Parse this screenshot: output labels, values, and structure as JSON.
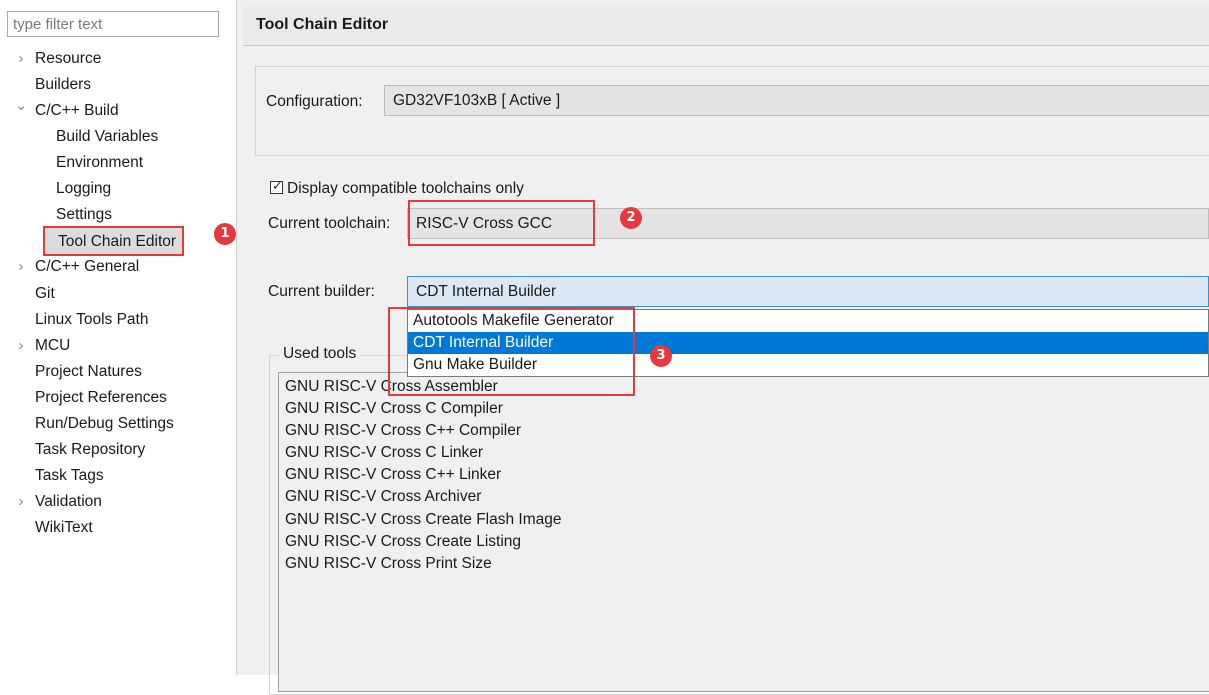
{
  "filter": {
    "placeholder": "type filter text"
  },
  "tree": {
    "items": [
      {
        "label": "Resource",
        "expander": "›"
      },
      {
        "label": "Builders"
      },
      {
        "label": "C/C++ Build",
        "expander": "⌄"
      },
      {
        "label": "Build Variables"
      },
      {
        "label": "Environment"
      },
      {
        "label": "Logging"
      },
      {
        "label": "Settings"
      },
      {
        "label": "Tool Chain Editor",
        "selected": true
      },
      {
        "label": "C/C++ General",
        "expander": "›"
      },
      {
        "label": "Git"
      },
      {
        "label": "Linux Tools Path"
      },
      {
        "label": "MCU",
        "expander": "›"
      },
      {
        "label": "Project Natures"
      },
      {
        "label": "Project References"
      },
      {
        "label": "Run/Debug Settings"
      },
      {
        "label": "Task Repository"
      },
      {
        "label": "Task Tags"
      },
      {
        "label": "Validation",
        "expander": "›"
      },
      {
        "label": "WikiText"
      }
    ]
  },
  "header": {
    "title": "Tool Chain Editor"
  },
  "configuration": {
    "label": "Configuration:",
    "value": "GD32VF103xB  [ Active ]"
  },
  "compatible_only": {
    "label": "Display compatible toolchains only",
    "checked": true
  },
  "toolchain": {
    "label": "Current toolchain:",
    "value": "RISC-V Cross GCC"
  },
  "builder": {
    "label": "Current builder:",
    "value": "CDT Internal Builder",
    "options": [
      "Autotools Makefile Generator",
      "CDT Internal Builder",
      "Gnu Make Builder"
    ],
    "selected_index": 1
  },
  "used_tools": {
    "legend": "Used tools",
    "items": [
      "GNU RISC-V Cross Assembler",
      "GNU RISC-V Cross C Compiler",
      "GNU RISC-V Cross C++ Compiler",
      "GNU RISC-V Cross C Linker",
      "GNU RISC-V Cross C++ Linker",
      "GNU RISC-V Cross Archiver",
      "GNU RISC-V Cross Create Flash Image",
      "GNU RISC-V Cross Create Listing",
      "GNU RISC-V Cross Print Size"
    ]
  },
  "annotations": {
    "badge_1": "1",
    "badge_2": "2",
    "badge_3": "3",
    "color": "#e5393e"
  },
  "colors": {
    "selection_blue": "#0078d7",
    "panel_bg": "#f0f0f0"
  }
}
